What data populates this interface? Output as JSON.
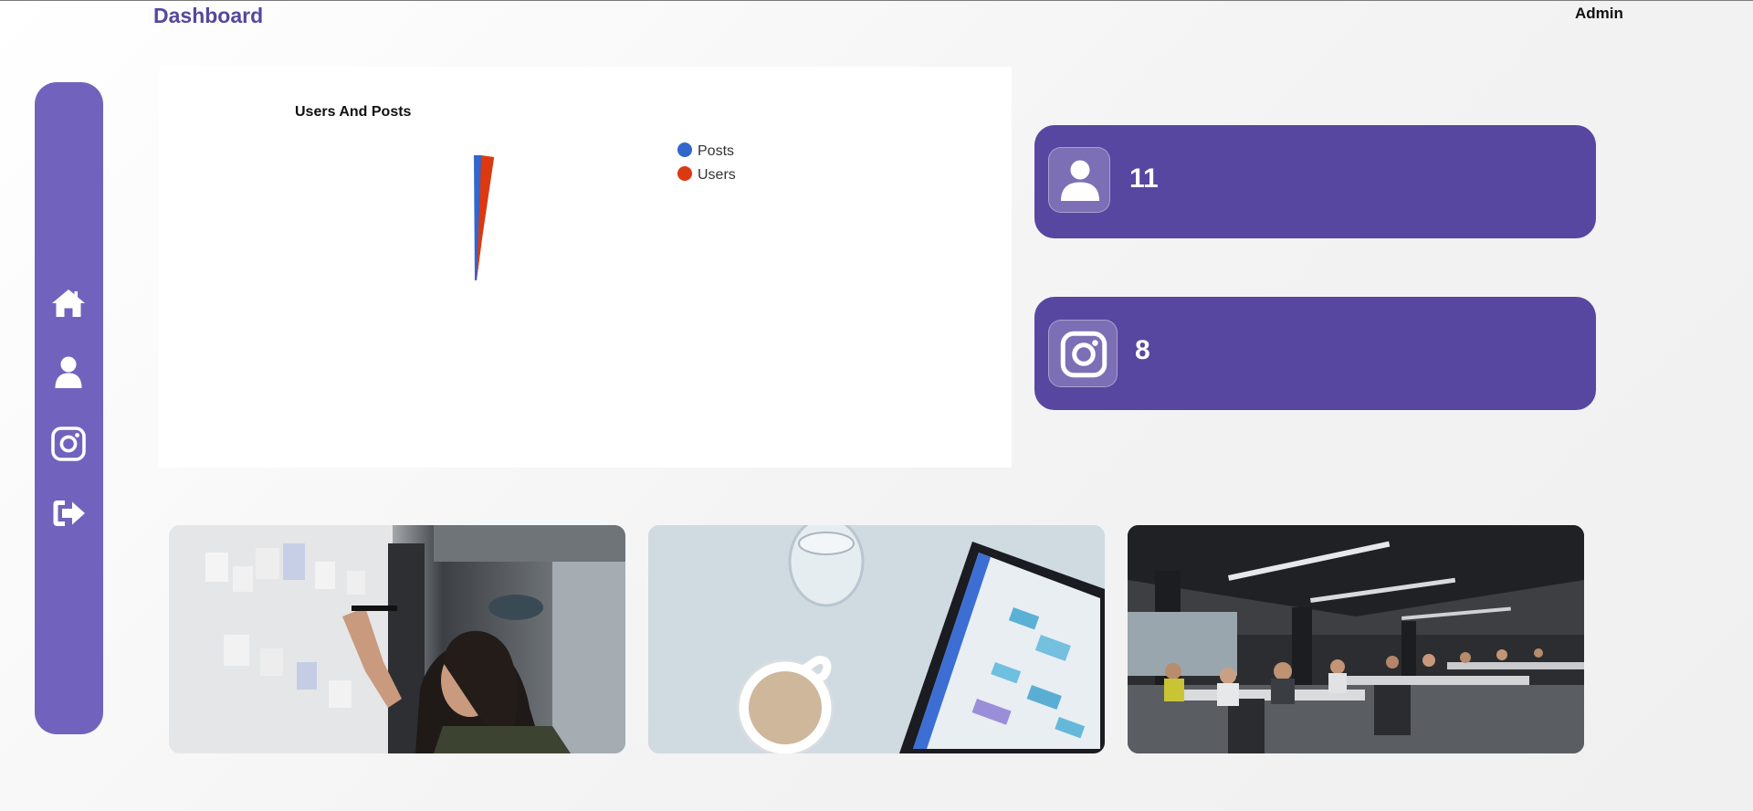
{
  "header": {
    "title": "Dashboard",
    "user": "Admin"
  },
  "sidebar": {
    "items": [
      {
        "icon": "home-icon",
        "name": "home"
      },
      {
        "icon": "user-icon",
        "name": "users"
      },
      {
        "icon": "instagram-icon",
        "name": "posts"
      },
      {
        "icon": "logout-icon",
        "name": "logout"
      }
    ]
  },
  "chart_data": {
    "type": "pie",
    "title": "Users And Posts",
    "categories": [
      "Posts",
      "Users"
    ],
    "series": [
      {
        "name": "Posts",
        "color": "#3366cc"
      },
      {
        "name": "Users",
        "color": "#dc3912"
      }
    ]
  },
  "stats": [
    {
      "icon": "user-icon",
      "value": "11"
    },
    {
      "icon": "instagram-icon",
      "value": "8"
    }
  ],
  "gallery": [
    {
      "name": "photo-whiteboard",
      "description_icon": "image-icon"
    },
    {
      "name": "photo-tablet-coffee",
      "description_icon": "image-icon"
    },
    {
      "name": "photo-open-office",
      "description_icon": "image-icon"
    }
  ],
  "colors": {
    "accent": "#57479e",
    "sidebar": "#7163bd",
    "card": "#5847a0",
    "posts": "#3366cc",
    "users": "#dc3912"
  }
}
